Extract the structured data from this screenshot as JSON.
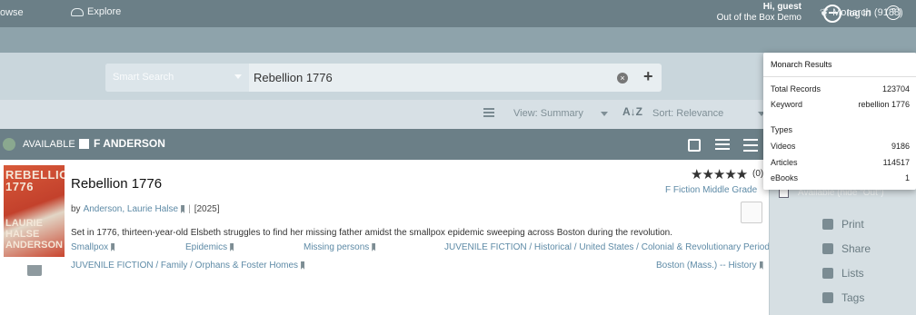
{
  "header": {
    "greeting": "Hi, guest",
    "org": "Out of the Box Demo",
    "login_label": "log in",
    "help_label": "?"
  },
  "nav": {
    "browse_label": "owse",
    "explore_label": "Explore",
    "monarch_label": "Monarch (9188)"
  },
  "search": {
    "mode_label": "Smart Search",
    "query": "Rebellion 1776",
    "clear_label": "×",
    "add_label": "+"
  },
  "toolbar": {
    "view_label": "View: Summary",
    "sort_label": "Sort: Relevance",
    "sort_icon": "A↓Z"
  },
  "results_bar": {
    "available_label": "AVAILABLE",
    "location_label": "F ANDERSON"
  },
  "result": {
    "cover_title": "REBELLION 1776",
    "cover_author": "LAURIE HALSE ANDERSON",
    "title": "Rebellion 1776",
    "by_prefix": "by",
    "author": "Anderson, Laurie Halse",
    "year": "[2025]",
    "description": "Set in 1776, thirteen-year-old Elsbeth struggles to find her missing father amidst the smallpox epidemic sweeping across Boston during the revolution.",
    "subjects": [
      "Smallpox",
      "Epidemics",
      "Missing persons",
      "JUVENILE FICTION / Historical / United States / Colonial & Revolutionary Periods",
      "JUVENILE FICTION / Family / Orphans & Foster Homes",
      "Boston (Mass.) -- History"
    ],
    "rating_stars": "★★★★★",
    "rating_count": "(0)",
    "call_number": "F Fiction Middle Grade"
  },
  "sidebar": {
    "availability_label": "Available (hide \"Out\")",
    "print_label": "Print",
    "share_label": "Share",
    "lists_label": "Lists",
    "tags_label": "Tags"
  },
  "monarch_popup": {
    "title": "Monarch Results",
    "total_label": "Total Records",
    "total_value": "123704",
    "keyword_label": "Keyword",
    "keyword_value": "rebellion 1776",
    "types_label": "Types",
    "types": [
      {
        "label": "Videos",
        "value": "9186"
      },
      {
        "label": "Articles",
        "value": "114517"
      },
      {
        "label": "eBooks",
        "value": "1"
      }
    ]
  }
}
